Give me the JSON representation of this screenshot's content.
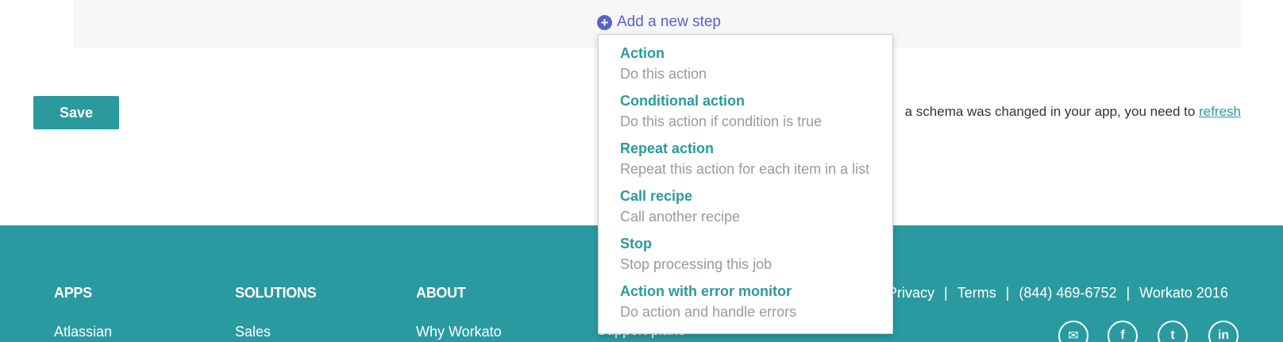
{
  "add_step": {
    "label": "Add a new step",
    "icon": "plus-circle-icon",
    "color": "#5863c8"
  },
  "save_button": {
    "label": "Save"
  },
  "schema_note": {
    "text": "a schema was changed in your app, you need to ",
    "link": "refresh"
  },
  "dropdown": {
    "options": [
      {
        "title": "Action",
        "desc": "Do this action"
      },
      {
        "title": "Conditional action",
        "desc": "Do this action if condition is true"
      },
      {
        "title": "Repeat action",
        "desc": "Repeat this action for each item in a list"
      },
      {
        "title": "Call recipe",
        "desc": "Call another recipe"
      },
      {
        "title": "Stop",
        "desc": "Stop processing this job"
      },
      {
        "title": "Action with error monitor",
        "desc": "Do action and handle errors"
      }
    ]
  },
  "footer": {
    "bg_color": "#2a9aa1",
    "columns": [
      {
        "heading": "APPS",
        "first_item": "Atlassian"
      },
      {
        "heading": "SOLUTIONS",
        "first_item": "Sales"
      },
      {
        "heading": "ABOUT",
        "first_item": "Why Workato"
      }
    ],
    "hidden_item": "Support plans",
    "links": {
      "privacy": "Privacy",
      "terms": "Terms",
      "phone": "(844) 469-6752",
      "company": "Workato 2016",
      "separator": "|"
    },
    "social": [
      {
        "name": "email-icon",
        "glyph": "✉"
      },
      {
        "name": "facebook-icon",
        "glyph": "f"
      },
      {
        "name": "twitter-icon",
        "glyph": "t"
      },
      {
        "name": "linkedin-icon",
        "glyph": "in"
      }
    ]
  }
}
